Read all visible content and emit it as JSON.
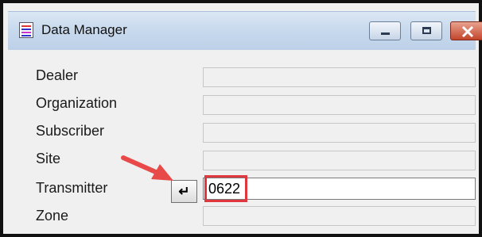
{
  "window": {
    "title": "Data Manager"
  },
  "titlebar_buttons": {
    "minimize": "minimize-icon",
    "maximize": "maximize-icon",
    "close": "close-icon"
  },
  "fields": [
    {
      "label": "Dealer",
      "value": ""
    },
    {
      "label": "Organization",
      "value": ""
    },
    {
      "label": "Subscriber",
      "value": ""
    },
    {
      "label": "Site",
      "value": ""
    },
    {
      "label": "Transmitter",
      "value": "0622"
    },
    {
      "label": "Zone",
      "value": ""
    }
  ],
  "enter_button": {
    "glyph": "↵"
  },
  "colors": {
    "highlight": "#e0363d",
    "arrow": "#e84a4a"
  }
}
